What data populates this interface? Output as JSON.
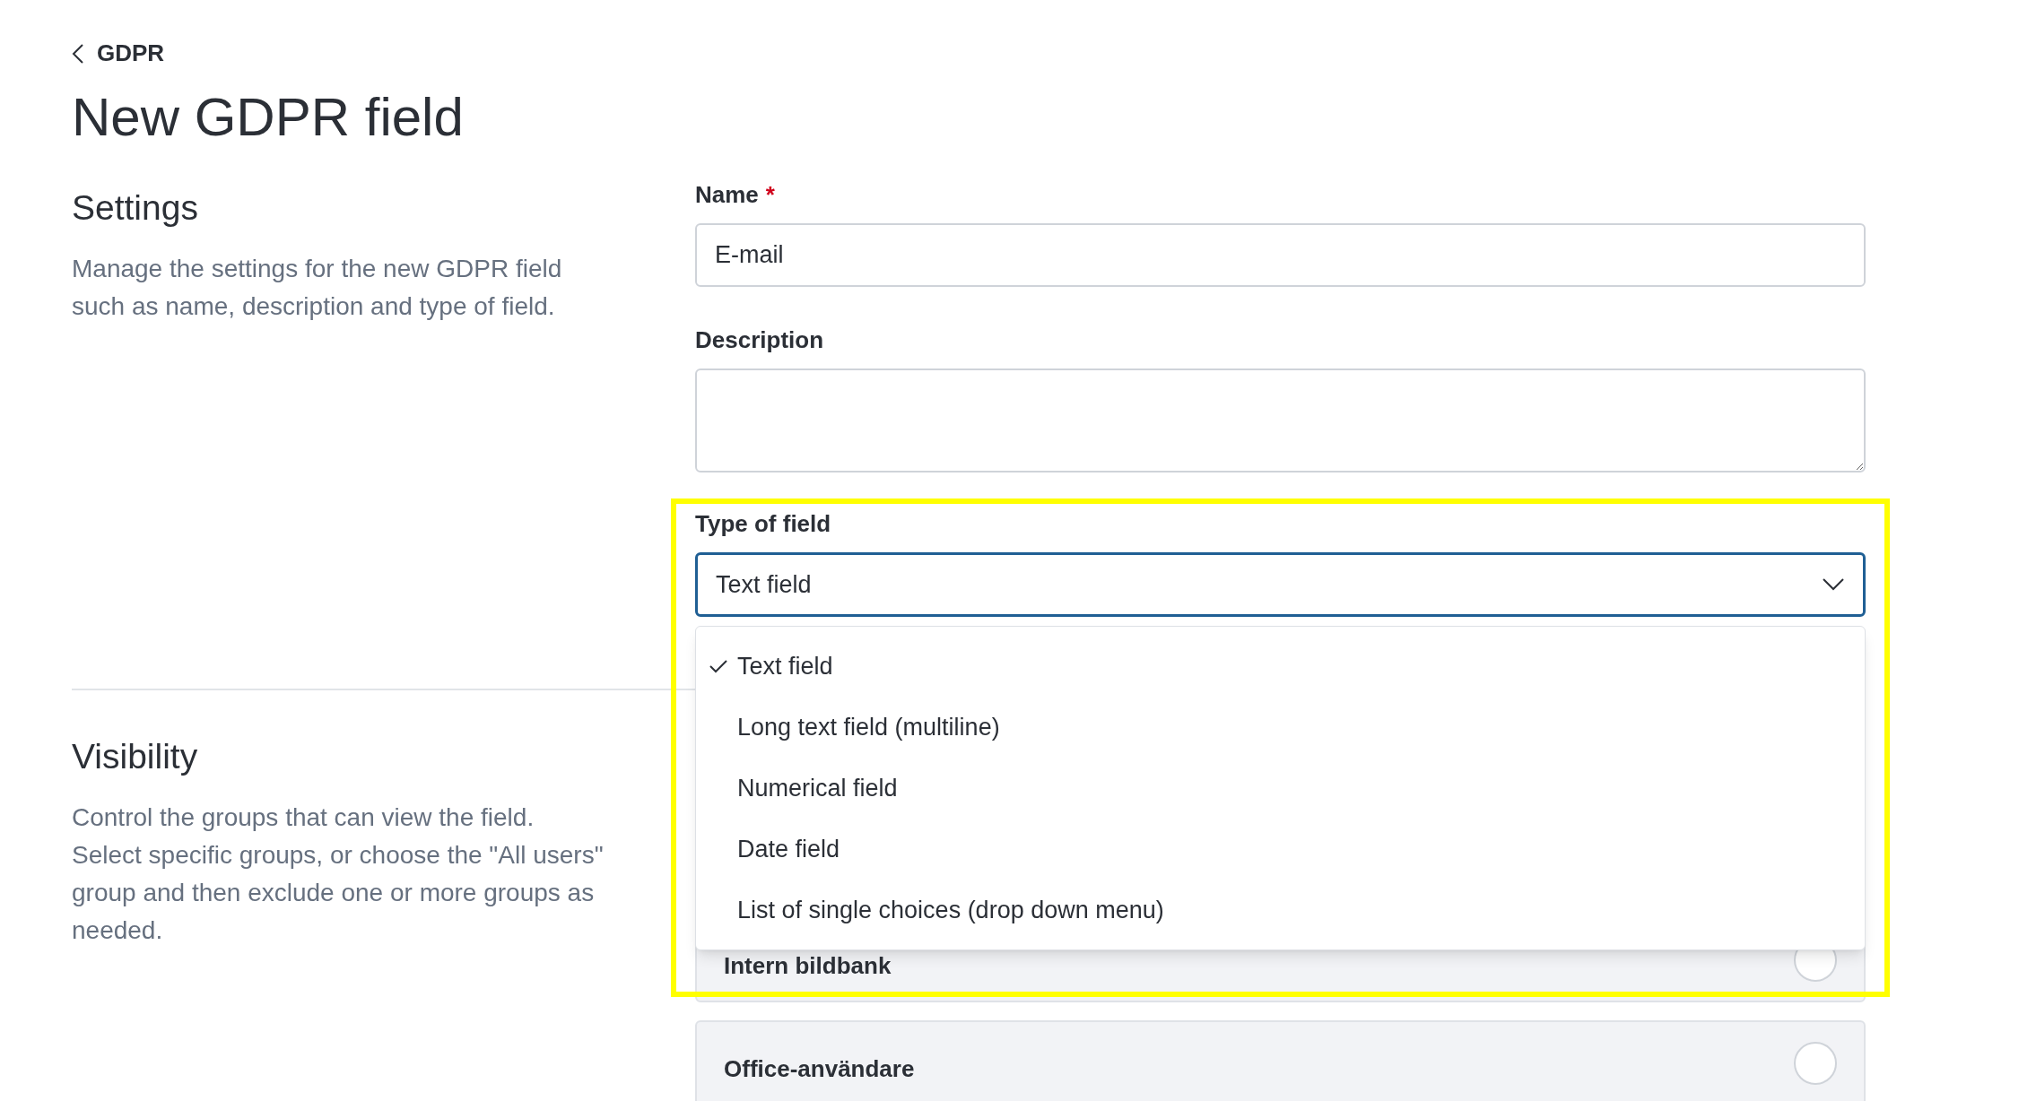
{
  "breadcrumb": {
    "back_label": "GDPR"
  },
  "title": "New GDPR field",
  "sections": [
    {
      "heading": "Settings",
      "description": "Manage the settings for the new GDPR field such as name, description and type of field."
    },
    {
      "heading": "Visibility",
      "description": "Control the groups that can view the field. Select specific groups, or choose the \"All users\" group and then exclude one or more groups as needed."
    }
  ],
  "form": {
    "name": {
      "label": "Name",
      "required_mark": "*",
      "value": "E-mail"
    },
    "description": {
      "label": "Description"
    },
    "type_of_field": {
      "label": "Type of field",
      "value": "Text field",
      "expanded": true,
      "options": [
        {
          "label": "Text field",
          "selected": true
        },
        {
          "label": "Long text field (multiline)",
          "selected": false
        },
        {
          "label": "Numerical field",
          "selected": false
        },
        {
          "label": "Date field",
          "selected": false
        },
        {
          "label": "List of single choices (drop down menu)",
          "selected": false
        }
      ]
    }
  },
  "groups": [
    {
      "name": "Intern bildbank",
      "checked": false
    },
    {
      "name": "Office-användare",
      "checked": false
    }
  ]
}
